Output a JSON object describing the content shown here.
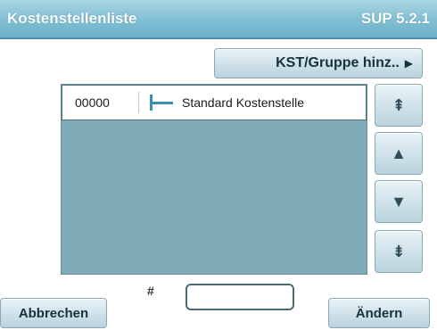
{
  "header": {
    "title": "Kostenstellenliste",
    "version": "SUP 5.2.1"
  },
  "toolbar": {
    "add_label": "KST/Gruppe hinz..",
    "add_arrow": "▶"
  },
  "list": {
    "items": [
      {
        "code": "00000",
        "name": "Standard Kostenstelle"
      }
    ]
  },
  "scroll": {
    "first": "⇞",
    "up": "▲",
    "down": "▼",
    "last": "⇟"
  },
  "footer": {
    "cancel_label": "Abbrechen",
    "hash_label": "#",
    "hash_value": "",
    "change_label": "Ändern"
  },
  "colors": {
    "header": "#7fbed3",
    "list_background": "#7faab6",
    "tree_line": "#3a8fb2"
  }
}
